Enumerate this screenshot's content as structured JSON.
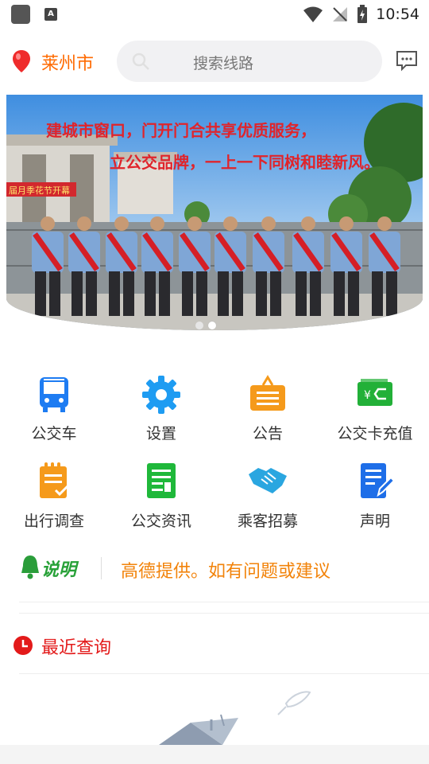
{
  "status_bar": {
    "time": "10:54"
  },
  "header": {
    "city": "莱州市",
    "search_placeholder": "搜索线路"
  },
  "banner": {
    "slogan_line1": "建城市窗口，门开门合共享优质服务，",
    "slogan_line2": "立公交品牌，一上一下同树和睦新风。",
    "sign_text": "届月季花节开幕",
    "page_count": 2,
    "active_page": 2
  },
  "grid": [
    {
      "label": "公交车",
      "icon": "bus-icon",
      "color": "#1e7cf2"
    },
    {
      "label": "设置",
      "icon": "gear-icon",
      "color": "#1e9cf2"
    },
    {
      "label": "公告",
      "icon": "announcement-icon",
      "color": "#f59a1b"
    },
    {
      "label": "公交卡充值",
      "icon": "card-recharge-icon",
      "color": "#22b038"
    },
    {
      "label": "出行调查",
      "icon": "survey-icon",
      "color": "#f59a1b"
    },
    {
      "label": "公交资讯",
      "icon": "news-icon",
      "color": "#1fb83a"
    },
    {
      "label": "乘客招募",
      "icon": "handshake-icon",
      "color": "#2aa6e0"
    },
    {
      "label": "声明",
      "icon": "statement-icon",
      "color": "#1e6ee8"
    }
  ],
  "notice": {
    "badge": "说明",
    "text": "高德提供。如有问题或建议"
  },
  "recent": {
    "label": "最近查询"
  }
}
